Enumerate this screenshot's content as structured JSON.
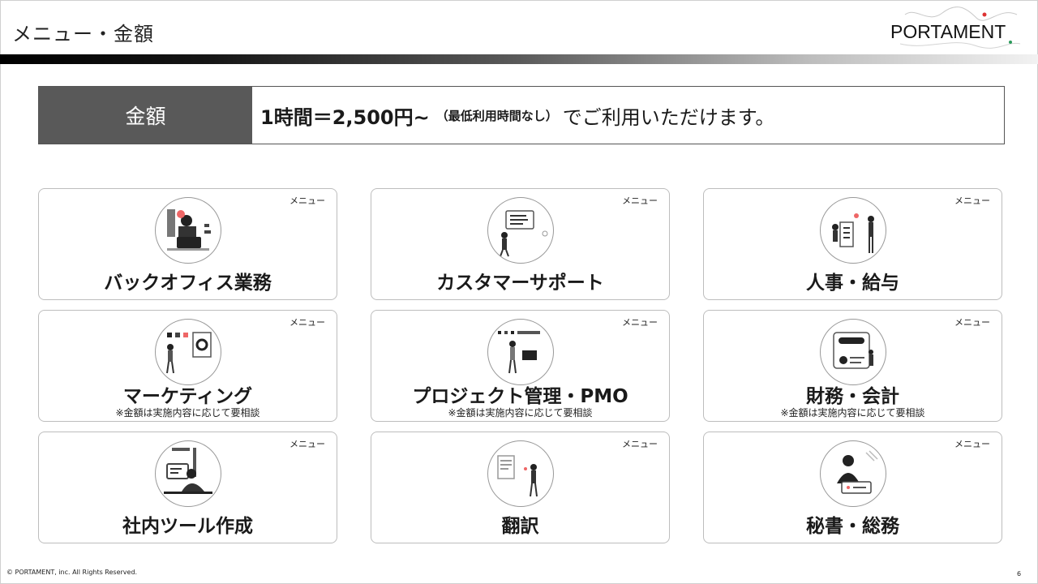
{
  "header": {
    "title": "メニュー・金額",
    "logo": "PORTAMENT"
  },
  "price": {
    "label": "金額",
    "main": "1時間＝2,500円~",
    "note": "（最低利用時間なし）",
    "suffix": "でご利用いただけます。"
  },
  "menu": {
    "tag": "メニュー",
    "items": [
      {
        "name": "バックオフィス業務",
        "note": "",
        "icon": "back-office-illustration"
      },
      {
        "name": "カスタマーサポート",
        "note": "",
        "icon": "customer-support-illustration"
      },
      {
        "name": "人事・給与",
        "note": "",
        "icon": "hr-payroll-illustration"
      },
      {
        "name": "マーケティング",
        "note": "※金額は実施内容に応じて要相談",
        "icon": "marketing-illustration"
      },
      {
        "name": "プロジェクト管理・PMO",
        "note": "※金額は実施内容に応じて要相談",
        "icon": "project-management-illustration"
      },
      {
        "name": "財務・会計",
        "note": "※金額は実施内容に応じて要相談",
        "icon": "finance-accounting-illustration"
      },
      {
        "name": "社内ツール作成",
        "note": "",
        "icon": "internal-tools-illustration"
      },
      {
        "name": "翻訳",
        "note": "",
        "icon": "translation-illustration"
      },
      {
        "name": "秘書・総務",
        "note": "",
        "icon": "secretary-general-affairs-illustration"
      }
    ]
  },
  "footer": {
    "copyright": "© PORTAMENT, inc. All Rights Reserved.",
    "page": "6"
  }
}
